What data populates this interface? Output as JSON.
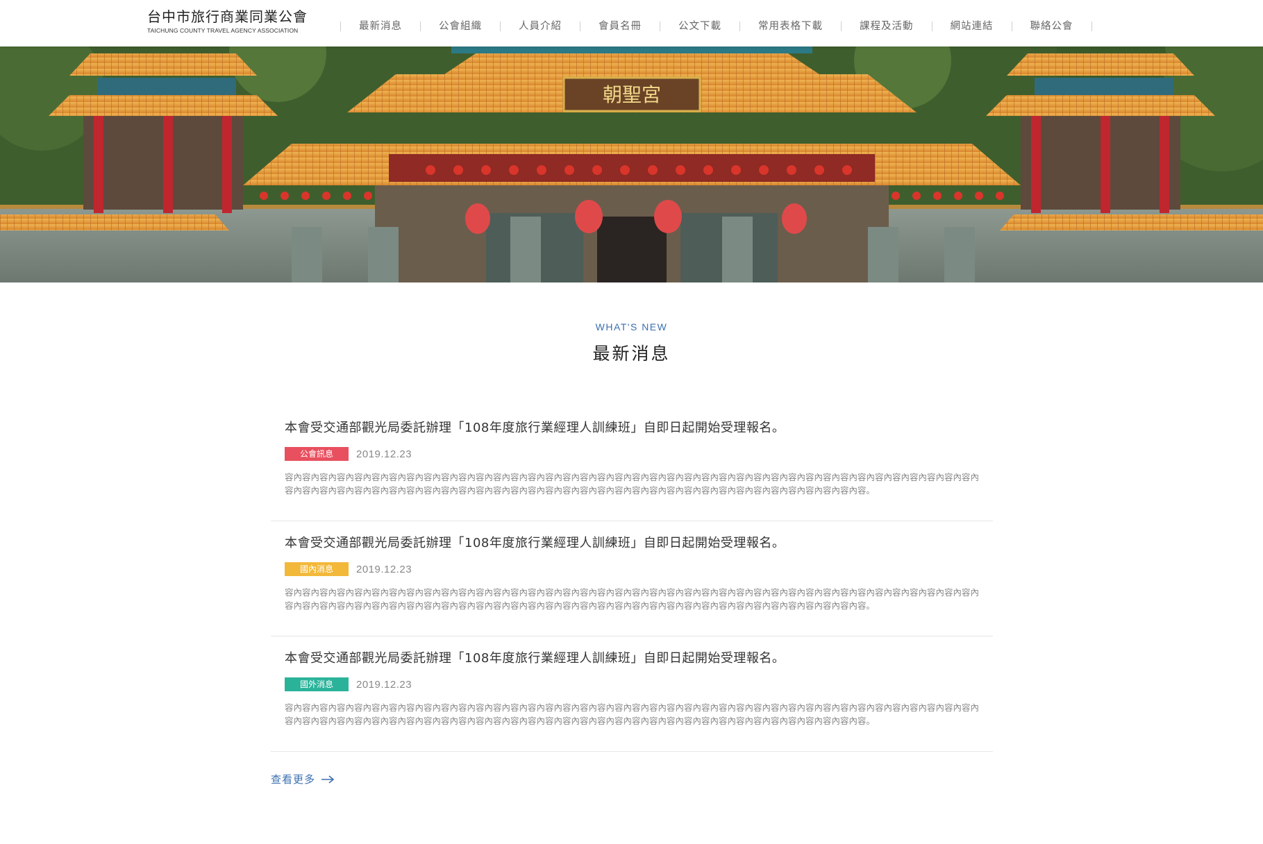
{
  "header": {
    "logo_zh": "台中市旅行商業同業公會",
    "logo_en": "TAICHUNG COUNTY TRAVEL AGENCY ASSOCIATION",
    "nav": [
      {
        "label": "最新消息"
      },
      {
        "label": "公會組織"
      },
      {
        "label": "人員介紹"
      },
      {
        "label": "會員名冊"
      },
      {
        "label": "公文下載"
      },
      {
        "label": "常用表格下載"
      },
      {
        "label": "課程及活動"
      },
      {
        "label": "網站連結"
      },
      {
        "label": "聯絡公會"
      }
    ]
  },
  "hero": {
    "plaque_text": "朝聖宮"
  },
  "section": {
    "subtitle_en": "WHAT'S NEW",
    "title_zh": "最新消息"
  },
  "news": [
    {
      "title": "本會受交通部觀光局委託辦理「108年度旅行業經理人訓練班」自即日起開始受理報名。",
      "tag": "公會訊息",
      "tag_color": "#e8505f",
      "date": "2019.12.23",
      "excerpt": "容內容內容內容內容內容內容內容內容內容內容內容內容內容內容內容內容內容內容內容內容內容內容內容內容內容內容內容內容內容內容內容內容內容內容內容內容內容內容內容內容內容內容內容內容內容內容內容內容內容內容內容內容內容內容內容內容內容內容內容內容內容內容內容內容內容內容內容內容內容內容內容內容內容。"
    },
    {
      "title": "本會受交通部觀光局委託辦理「108年度旅行業經理人訓練班」自即日起開始受理報名。",
      "tag": "國內消息",
      "tag_color": "#f2b83a",
      "date": "2019.12.23",
      "excerpt": "容內容內容內容內容內容內容內容內容內容內容內容內容內容內容內容內容內容內容內容內容內容內容內容內容內容內容內容內容內容內容內容內容內容內容內容內容內容內容內容內容內容內容內容內容內容內容內容內容內容內容內容內容內容內容內容內容內容內容內容內容內容內容內容內容內容內容內容內容內容內容內容內容內容。"
    },
    {
      "title": "本會受交通部觀光局委託辦理「108年度旅行業經理人訓練班」自即日起開始受理報名。",
      "tag": "國外消息",
      "tag_color": "#2bb39a",
      "date": "2019.12.23",
      "excerpt": "容內容內容內容內容內容內容內容內容內容內容內容內容內容內容內容內容內容內容內容內容內容內容內容內容內容內容內容內容內容內容內容內容內容內容內容內容內容內容內容內容內容內容內容內容內容內容內容內容內容內容內容內容內容內容內容內容內容內容內容內容內容內容內容內容內容內容內容內容內容內容內容內容內容。"
    }
  ],
  "more": {
    "label": "查看更多",
    "icon": "arrow-right-icon"
  }
}
